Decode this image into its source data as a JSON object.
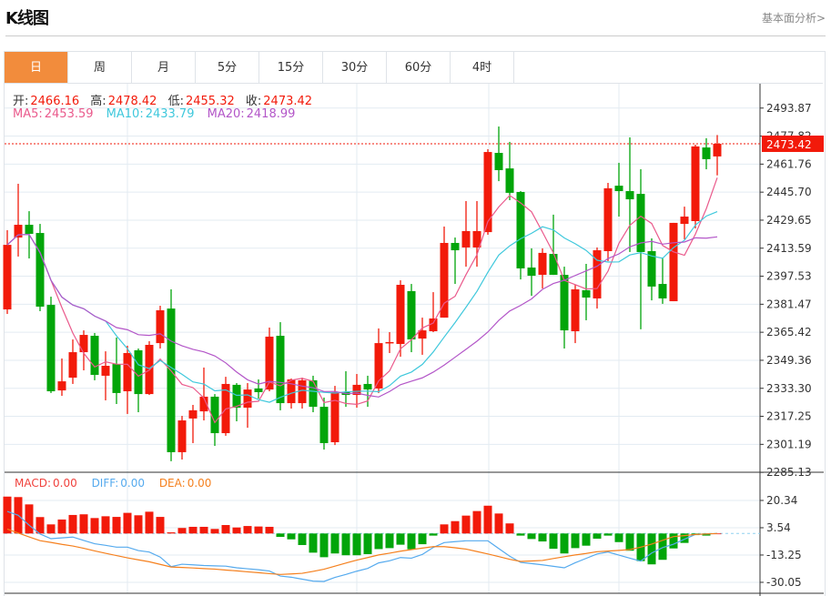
{
  "header": {
    "title": "K线图",
    "link": "基本面分析>"
  },
  "tabs": [
    {
      "label": "日",
      "active": true
    },
    {
      "label": "周",
      "active": false
    },
    {
      "label": "月",
      "active": false
    },
    {
      "label": "5分",
      "active": false
    },
    {
      "label": "15分",
      "active": false
    },
    {
      "label": "30分",
      "active": false
    },
    {
      "label": "60分",
      "active": false
    },
    {
      "label": "4时",
      "active": false
    }
  ],
  "ohlc_legend": {
    "open_label": "开:",
    "open": "2466.16",
    "high_label": "高:",
    "high": "2478.42",
    "low_label": "低:",
    "low": "2455.32",
    "close_label": "收:",
    "close": "2473.42"
  },
  "ma_legend": {
    "ma5_label": "MA5:",
    "ma5": "2453.59",
    "ma10_label": "MA10:",
    "ma10": "2433.79",
    "ma20_label": "MA20:",
    "ma20": "2418.99"
  },
  "macd_legend": {
    "macd_label": "MACD:",
    "macd": "0.00",
    "diff_label": "DIFF:",
    "diff": "0.00",
    "dea_label": "DEA:",
    "dea": "0.00"
  },
  "colors": {
    "up": "#f21a0a",
    "down": "#02a50a",
    "active_tab": "#f28c3c",
    "ma5": "#ea5a8c",
    "ma10": "#3fc8dc",
    "ma20": "#b356c8",
    "diff": "#55aaee",
    "dea": "#f5801e"
  },
  "chart_data": [
    {
      "type": "candlestick",
      "title": "K线图",
      "last_price": "2473.42",
      "y_ticks": [
        "2493.87",
        "2477.82",
        "2461.76",
        "2445.70",
        "2429.65",
        "2413.59",
        "2397.53",
        "2381.47",
        "2365.42",
        "2349.36",
        "2333.30",
        "2317.25",
        "2301.19",
        "2285.13"
      ],
      "ylim": [
        2285.13,
        2493.87
      ],
      "candles": [
        [
          2378.5,
          2423.9,
          2375.9,
          2415.5
        ],
        [
          2419.7,
          2450.5,
          2408.8,
          2427.0
        ],
        [
          2427.0,
          2434.8,
          2407.7,
          2421.8
        ],
        [
          2422.3,
          2427.5,
          2377.5,
          2380.1
        ],
        [
          2381.1,
          2385.8,
          2330.6,
          2331.6
        ],
        [
          2332.1,
          2350.4,
          2329.0,
          2337.3
        ],
        [
          2339.4,
          2361.3,
          2335.8,
          2354.0
        ],
        [
          2354.0,
          2366.5,
          2343.6,
          2363.9
        ],
        [
          2363.4,
          2365.0,
          2337.9,
          2341.0
        ],
        [
          2340.5,
          2354.5,
          2326.4,
          2346.2
        ],
        [
          2347.2,
          2362.4,
          2324.3,
          2330.6
        ],
        [
          2331.6,
          2357.7,
          2318.6,
          2353.5
        ],
        [
          2355.1,
          2356.1,
          2319.6,
          2330.0
        ],
        [
          2330.0,
          2360.3,
          2329.5,
          2358.2
        ],
        [
          2359.2,
          2380.6,
          2356.1,
          2378.0
        ],
        [
          2379.0,
          2390.0,
          2291.5,
          2296.7
        ],
        [
          2296.7,
          2317.5,
          2292.5,
          2314.9
        ],
        [
          2316.0,
          2323.8,
          2301.9,
          2320.7
        ],
        [
          2320.1,
          2345.2,
          2314.9,
          2328.5
        ],
        [
          2328.5,
          2330.0,
          2300.3,
          2307.6
        ],
        [
          2307.6,
          2339.9,
          2306.1,
          2335.8
        ],
        [
          2335.3,
          2336.3,
          2314.4,
          2322.2
        ],
        [
          2322.2,
          2336.3,
          2310.7,
          2332.6
        ],
        [
          2333.2,
          2338.4,
          2327.4,
          2331.1
        ],
        [
          2332.6,
          2368.1,
          2331.6,
          2362.9
        ],
        [
          2363.4,
          2371.2,
          2320.7,
          2324.8
        ],
        [
          2324.8,
          2338.9,
          2321.7,
          2338.4
        ],
        [
          2324.8,
          2339.4,
          2321.7,
          2337.9
        ],
        [
          2337.9,
          2340.5,
          2319.6,
          2322.7
        ],
        [
          2322.7,
          2328.0,
          2298.2,
          2301.9
        ],
        [
          2302.4,
          2334.7,
          2300.8,
          2331.1
        ],
        [
          2331.1,
          2343.1,
          2322.7,
          2329.5
        ],
        [
          2329.5,
          2341.5,
          2322.2,
          2335.3
        ],
        [
          2335.8,
          2340.5,
          2322.7,
          2332.6
        ],
        [
          2333.2,
          2367.6,
          2330.6,
          2359.2
        ],
        [
          2359.2,
          2365.5,
          2353.5,
          2359.8
        ],
        [
          2358.7,
          2395.2,
          2351.4,
          2392.6
        ],
        [
          2389.0,
          2393.1,
          2354.0,
          2361.3
        ],
        [
          2361.8,
          2373.8,
          2352.5,
          2366.5
        ],
        [
          2366.0,
          2388.4,
          2365.5,
          2373.3
        ],
        [
          2373.8,
          2426.0,
          2373.8,
          2416.6
        ],
        [
          2416.6,
          2419.7,
          2393.1,
          2412.4
        ],
        [
          2414.0,
          2440.6,
          2403.0,
          2423.4
        ],
        [
          2414.0,
          2440.6,
          2403.0,
          2423.4
        ],
        [
          2422.8,
          2470.3,
          2421.3,
          2468.7
        ],
        [
          2468.2,
          2483.3,
          2452.0,
          2458.3
        ],
        [
          2459.3,
          2474.5,
          2441.1,
          2445.3
        ],
        [
          2445.8,
          2446.3,
          2395.7,
          2402.0
        ],
        [
          2402.5,
          2413.5,
          2386.3,
          2397.8
        ],
        [
          2398.3,
          2413.5,
          2390.5,
          2410.9
        ],
        [
          2410.3,
          2432.8,
          2398.3,
          2398.3
        ],
        [
          2398.3,
          2403.0,
          2356.1,
          2366.5
        ],
        [
          2366.0,
          2392.6,
          2359.2,
          2390.0
        ],
        [
          2389.5,
          2404.6,
          2372.3,
          2385.3
        ],
        [
          2384.8,
          2414.0,
          2379.0,
          2412.4
        ],
        [
          2411.9,
          2451.0,
          2406.2,
          2447.9
        ],
        [
          2449.4,
          2462.5,
          2431.7,
          2446.3
        ],
        [
          2446.3,
          2477.1,
          2411.4,
          2441.6
        ],
        [
          2444.7,
          2458.8,
          2367.1,
          2411.4
        ],
        [
          2411.9,
          2419.2,
          2383.7,
          2391.6
        ],
        [
          2393.1,
          2408.2,
          2381.7,
          2384.8
        ],
        [
          2383.2,
          2428.1,
          2383.2,
          2428.1
        ],
        [
          2427.5,
          2437.4,
          2418.7,
          2431.7
        ],
        [
          2429.1,
          2472.9,
          2424.9,
          2471.9
        ],
        [
          2471.3,
          2476.6,
          2458.8,
          2464.6
        ],
        [
          2466.16,
          2478.42,
          2455.32,
          2473.42
        ]
      ],
      "candle_format": [
        "open",
        "high",
        "low",
        "close"
      ],
      "moving_averages": [
        "MA5",
        "MA10",
        "MA20"
      ]
    },
    {
      "type": "bar+line",
      "title": "MACD",
      "y_ticks": [
        "20.34",
        "3.54",
        "-13.25",
        "-30.05"
      ],
      "macd": [
        22.7,
        22.4,
        17.9,
        10.1,
        5.6,
        8.6,
        11.4,
        11.8,
        9.5,
        10.6,
        10.2,
        12.7,
        11.2,
        13.4,
        10.2,
        0.7,
        3.4,
        4.1,
        4.1,
        2.8,
        5.2,
        3.7,
        4.6,
        4.3,
        4.1,
        -2.1,
        -3.6,
        -7.1,
        -11.8,
        -14.6,
        -12.3,
        -13.4,
        -13.4,
        -12.7,
        -9.6,
        -9.0,
        -6.9,
        -9.7,
        -6.6,
        -1.3,
        5.6,
        7.6,
        11.0,
        13.8,
        17.1,
        12.3,
        6.2,
        -1.3,
        -3.4,
        -4.9,
        -9.4,
        -12.3,
        -9.0,
        -7.5,
        -3.2,
        -1.3,
        -5.3,
        -10.6,
        -17.0,
        -19.0,
        -16.2,
        -9.2,
        -5.8,
        -1.0,
        -1.3,
        0.0
      ],
      "diff": [
        13.6,
        11.2,
        5.1,
        -0.3,
        -3.2,
        -2.7,
        -2.2,
        -4.3,
        -6.3,
        -7.3,
        -8.4,
        -8.4,
        -10.5,
        -11.4,
        -14.5,
        -20.4,
        -18.9,
        -19.3,
        -19.7,
        -19.9,
        -20.1,
        -21.1,
        -21.7,
        -22.3,
        -23.1,
        -26.2,
        -26.9,
        -28.1,
        -29.3,
        -29.5,
        -27.0,
        -25.2,
        -23.2,
        -21.5,
        -18.1,
        -16.8,
        -14.8,
        -15.2,
        -12.9,
        -8.6,
        -5.6,
        -5.0,
        -4.5,
        -4.5,
        -4.5,
        -9.3,
        -14.0,
        -17.8,
        -18.5,
        -19.3,
        -20.2,
        -21.1,
        -18.0,
        -15.3,
        -12.6,
        -11.4,
        -13.3,
        -15.2,
        -17.0,
        -12.0,
        -8.7,
        -6.6,
        -3.5,
        -0.6,
        -0.3,
        0.0
      ],
      "dea": [
        2.7,
        0.3,
        -2.1,
        -4.4,
        -5.5,
        -6.7,
        -7.7,
        -9.1,
        -10.7,
        -12.2,
        -13.6,
        -15.0,
        -16.2,
        -17.4,
        -19.0,
        -20.6,
        -20.9,
        -21.2,
        -21.6,
        -21.9,
        -22.5,
        -23.0,
        -23.6,
        -24.1,
        -24.7,
        -25.2,
        -24.9,
        -24.5,
        -23.3,
        -22.0,
        -20.1,
        -18.2,
        -16.4,
        -14.8,
        -13.2,
        -12.1,
        -10.9,
        -9.9,
        -9.0,
        -8.1,
        -8.1,
        -8.8,
        -9.6,
        -11.1,
        -12.6,
        -14.2,
        -15.9,
        -17.2,
        -16.9,
        -16.6,
        -15.4,
        -14.3,
        -13.2,
        -12.3,
        -11.2,
        -10.8,
        -10.4,
        -9.9,
        -8.4,
        -6.5,
        -4.2,
        -1.9,
        -1.3,
        -0.6,
        -0.3,
        0.0
      ]
    }
  ]
}
